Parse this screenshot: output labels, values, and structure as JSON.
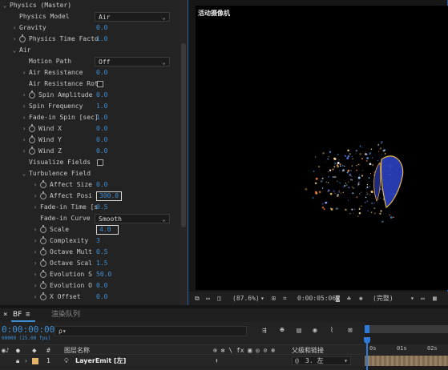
{
  "effect_controls": {
    "rows": [
      {
        "label": "Physics (Master)",
        "indent": 0,
        "twirl": "open"
      },
      {
        "label": "Physics Model",
        "indent": 1,
        "control": "dropdown",
        "value": "Air"
      },
      {
        "label": "Gravity",
        "indent": 1,
        "twirl": "closed",
        "value": "0.0"
      },
      {
        "label": "Physics Time Facto",
        "indent": 1,
        "twirl": "closed",
        "stopwatch": true,
        "value": "1.0"
      },
      {
        "label": "Air",
        "indent": 1,
        "twirl": "open"
      },
      {
        "label": "Motion Path",
        "indent": 2,
        "control": "dropdown",
        "value": "Off"
      },
      {
        "label": "Air Resistance",
        "indent": 2,
        "twirl": "closed",
        "value": "0.0"
      },
      {
        "label": "Air Resistance Rot",
        "indent": 2,
        "control": "checkbox"
      },
      {
        "label": "Spin Amplitude",
        "indent": 2,
        "twirl": "closed",
        "stopwatch": true,
        "value": "0.0"
      },
      {
        "label": "Spin Frequency",
        "indent": 2,
        "twirl": "closed",
        "value": "1.0"
      },
      {
        "label": "Fade-in Spin [sec]",
        "indent": 2,
        "twirl": "closed",
        "value": "1.0"
      },
      {
        "label": "Wind X",
        "indent": 2,
        "twirl": "closed",
        "stopwatch": true,
        "value": "0.0"
      },
      {
        "label": "Wind Y",
        "indent": 2,
        "twirl": "closed",
        "stopwatch": true,
        "value": "0.0"
      },
      {
        "label": "Wind Z",
        "indent": 2,
        "twirl": "closed",
        "stopwatch": true,
        "value": "0.0"
      },
      {
        "label": "Visualize Fields",
        "indent": 2,
        "control": "checkbox"
      },
      {
        "label": "Turbulence Field",
        "indent": 2,
        "twirl": "open"
      },
      {
        "label": "Affect Size",
        "indent": 3,
        "twirl": "closed",
        "stopwatch": true,
        "value": "0.0"
      },
      {
        "label": "Affect Posi",
        "indent": 3,
        "twirl": "closed",
        "stopwatch": true,
        "value": "300.0",
        "boxed": true
      },
      {
        "label": "Fade-in Time [s",
        "indent": 3,
        "twirl": "closed",
        "value": "0.5"
      },
      {
        "label": "Fade-in Curve",
        "indent": 3,
        "control": "dropdown",
        "value": "Smooth"
      },
      {
        "label": "Scale",
        "indent": 3,
        "twirl": "closed",
        "stopwatch": true,
        "value": "4.0",
        "boxed": true
      },
      {
        "label": "Complexity",
        "indent": 3,
        "twirl": "closed",
        "stopwatch": true,
        "value": "3"
      },
      {
        "label": "Octave Mult",
        "indent": 3,
        "twirl": "closed",
        "stopwatch": true,
        "value": "0.5"
      },
      {
        "label": "Octave Scal",
        "indent": 3,
        "twirl": "closed",
        "stopwatch": true,
        "value": "1.5"
      },
      {
        "label": "Evolution S",
        "indent": 3,
        "twirl": "closed",
        "stopwatch": true,
        "value": "50.0"
      },
      {
        "label": "Evolution O",
        "indent": 3,
        "twirl": "closed",
        "stopwatch": true,
        "value": "0.0"
      },
      {
        "label": "X Offset",
        "indent": 3,
        "twirl": "closed",
        "stopwatch": true,
        "value": "0.0"
      }
    ]
  },
  "composition": {
    "camera_label": "活动摄像机",
    "toolbar": {
      "zoom": "(87.6%)",
      "timecode": "0:00:05:06",
      "resolution": "(完整)"
    }
  },
  "timeline": {
    "tabs": {
      "active": "BF",
      "menu": "≡",
      "other": "渲染队列"
    },
    "timecode": "0:00:00:00",
    "timecode_sub": "00000 (25.00 fps)",
    "search_placeholder": "ρ▾",
    "columns": {
      "num": "#",
      "layer_name": "图层名称",
      "parent": "父级和链接"
    },
    "ruler_ticks": [
      "0s",
      "01s",
      "02s"
    ],
    "layer": {
      "number": "1",
      "name": "LayerEmit [左]",
      "parent": "3. 左"
    }
  },
  "colors": {
    "accent": "#3f8fd6",
    "panel_border": "#2a5fa0",
    "layer_label": "#e3b46a"
  }
}
